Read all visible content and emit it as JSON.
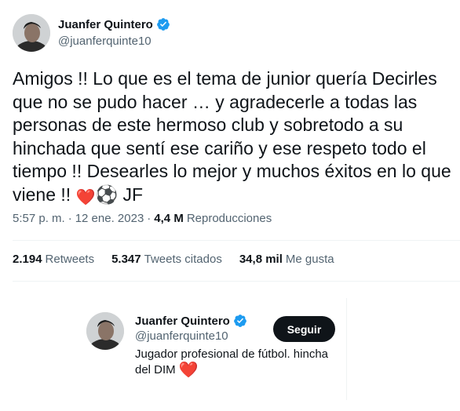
{
  "tweet": {
    "author_name": "Juanfer Quintero",
    "author_handle": "@juanferquinte10",
    "text": "Amigos !! Lo que es el tema de junior quería Decirles que no se pudo hacer … y agradecerle a todas las personas de este hermoso club y sobretodo a su hinchada que sentí ese cariño y ese respeto todo el tiempo !! Desearles lo mejor y muchos éxitos en lo que viene !! ",
    "signature": "JF",
    "heart_emoji": "❤️",
    "ball_emoji": "⚽",
    "time": "5:57 p. m.",
    "separator": "·",
    "date": "12 ene. 2023",
    "views_count": "4,4 M",
    "views_label": "Reproducciones"
  },
  "stats": {
    "retweets_count": "2.194",
    "retweets_label": "Retweets",
    "quotes_count": "5.347",
    "quotes_label": "Tweets citados",
    "likes_count": "34,8 mil",
    "likes_label": "Me gusta"
  },
  "profile_card": {
    "name": "Juanfer Quintero",
    "handle": "@juanferquinte10",
    "follow_label": "Seguir",
    "bio": "Jugador profesional de fútbol. hincha del DIM "
  },
  "colors": {
    "verified_blue": "#1d9bf0",
    "heart_red": "#e0245e",
    "secondary_text": "#536471"
  }
}
